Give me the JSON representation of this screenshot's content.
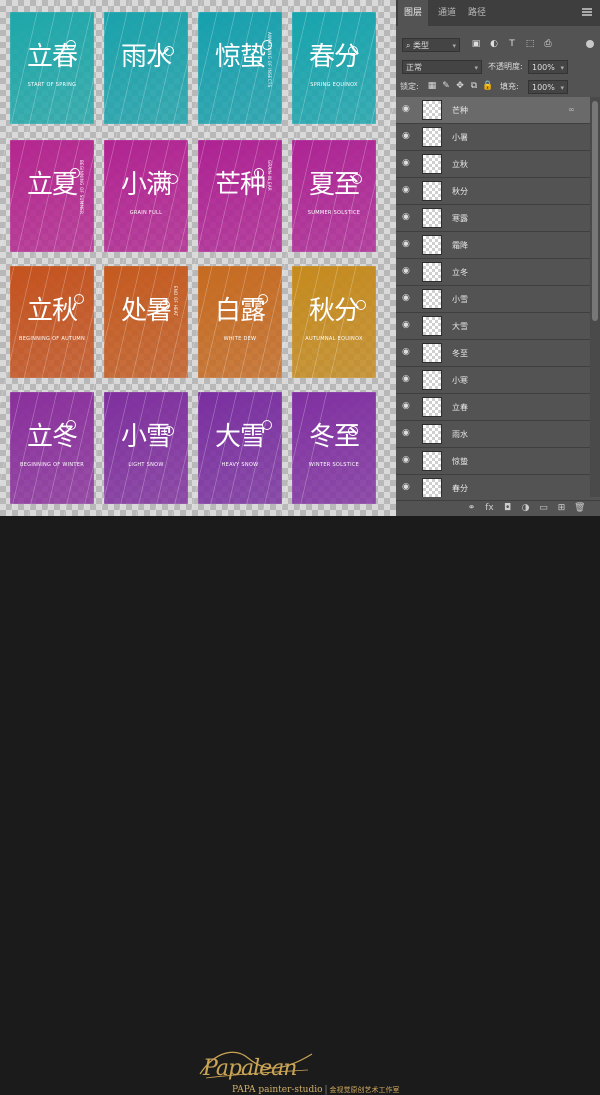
{
  "canvas": {
    "cards": [
      {
        "bg": "#1ea7a9",
        "glyph": "立春",
        "sub": "START OF SPRING",
        "vert": false
      },
      {
        "bg": "#1aa2ab",
        "glyph": "雨水",
        "sub": "",
        "vert": false
      },
      {
        "bg": "#16a0ad",
        "glyph": "惊蛰",
        "sub": "AWAKENING OF INSECTS",
        "vert": true
      },
      {
        "bg": "#17a4ad",
        "glyph": "春分",
        "sub": "SPRING EQUINOX",
        "vert": false
      },
      {
        "bg": "#b4268f",
        "glyph": "立夏",
        "sub": "BEGINNING OF SUMMER",
        "vert": true
      },
      {
        "bg": "#b12391",
        "glyph": "小满",
        "sub": "GRAIN FULL",
        "vert": false
      },
      {
        "bg": "#ae2293",
        "glyph": "芒种",
        "sub": "GRAIN IN EAR",
        "vert": true
      },
      {
        "bg": "#ad2494",
        "glyph": "夏至",
        "sub": "SUMMER SOLSTICE",
        "vert": false
      },
      {
        "bg": "#c4521e",
        "glyph": "立秋",
        "sub": "BEGINNING OF AUTUMN",
        "vert": false
      },
      {
        "bg": "#c45a1f",
        "glyph": "处暑",
        "sub": "END OF HEAT",
        "vert": true
      },
      {
        "bg": "#c66a20",
        "glyph": "白露",
        "sub": "WHITE DEW",
        "vert": false
      },
      {
        "bg": "#c58a1d",
        "glyph": "秋分",
        "sub": "AUTUMNAL EQUINOX",
        "vert": false
      },
      {
        "bg": "#8a2f9c",
        "glyph": "立冬",
        "sub": "BEGINNING OF WINTER",
        "vert": false
      },
      {
        "bg": "#7f2f9e",
        "glyph": "小雪",
        "sub": "LIGHT SNOW",
        "vert": false
      },
      {
        "bg": "#7a2fa0",
        "glyph": "大雪",
        "sub": "HEAVY SNOW",
        "vert": false
      },
      {
        "bg": "#8030a1",
        "glyph": "冬至",
        "sub": "WINTER SOLSTICE",
        "vert": false
      }
    ]
  },
  "panel": {
    "tabs": [
      "图层",
      "通道",
      "路径"
    ],
    "filter": {
      "kind": "类型",
      "icons": [
        "image-filter-icon",
        "adjust-filter-icon",
        "text-filter-icon",
        "shape-filter-icon",
        "smart-filter-icon"
      ]
    },
    "blend_mode": "正常",
    "opacity_label": "不透明度:",
    "opacity_value": "100%",
    "lock_label": "锁定:",
    "fill_label": "填充:",
    "fill_value": "100%",
    "layers": [
      {
        "name": "芒种",
        "selected": true,
        "linked": true
      },
      {
        "name": "小暑",
        "selected": false,
        "linked": false
      },
      {
        "name": "立秋",
        "selected": false,
        "linked": false
      },
      {
        "name": "秋分",
        "selected": false,
        "linked": false
      },
      {
        "name": "寒露",
        "selected": false,
        "linked": false
      },
      {
        "name": "霜降",
        "selected": false,
        "linked": false
      },
      {
        "name": "立冬",
        "selected": false,
        "linked": false
      },
      {
        "name": "小雪",
        "selected": false,
        "linked": false
      },
      {
        "name": "大雪",
        "selected": false,
        "linked": false
      },
      {
        "name": "冬至",
        "selected": false,
        "linked": false
      },
      {
        "name": "小寒",
        "selected": false,
        "linked": false
      },
      {
        "name": "立春",
        "selected": false,
        "linked": false
      },
      {
        "name": "雨水",
        "selected": false,
        "linked": false
      },
      {
        "name": "惊蛰",
        "selected": false,
        "linked": false
      },
      {
        "name": "春分",
        "selected": false,
        "linked": false
      }
    ],
    "bottom_icons": [
      "link-layers-icon",
      "fx-icon",
      "mask-icon",
      "adjustment-icon",
      "group-icon",
      "new-layer-icon",
      "trash-icon"
    ]
  },
  "footer": {
    "signature": "Papalean",
    "studio": "PAPA painter-studio",
    "separator": "|",
    "studio_cn": "金视觉原创艺术工作室"
  }
}
